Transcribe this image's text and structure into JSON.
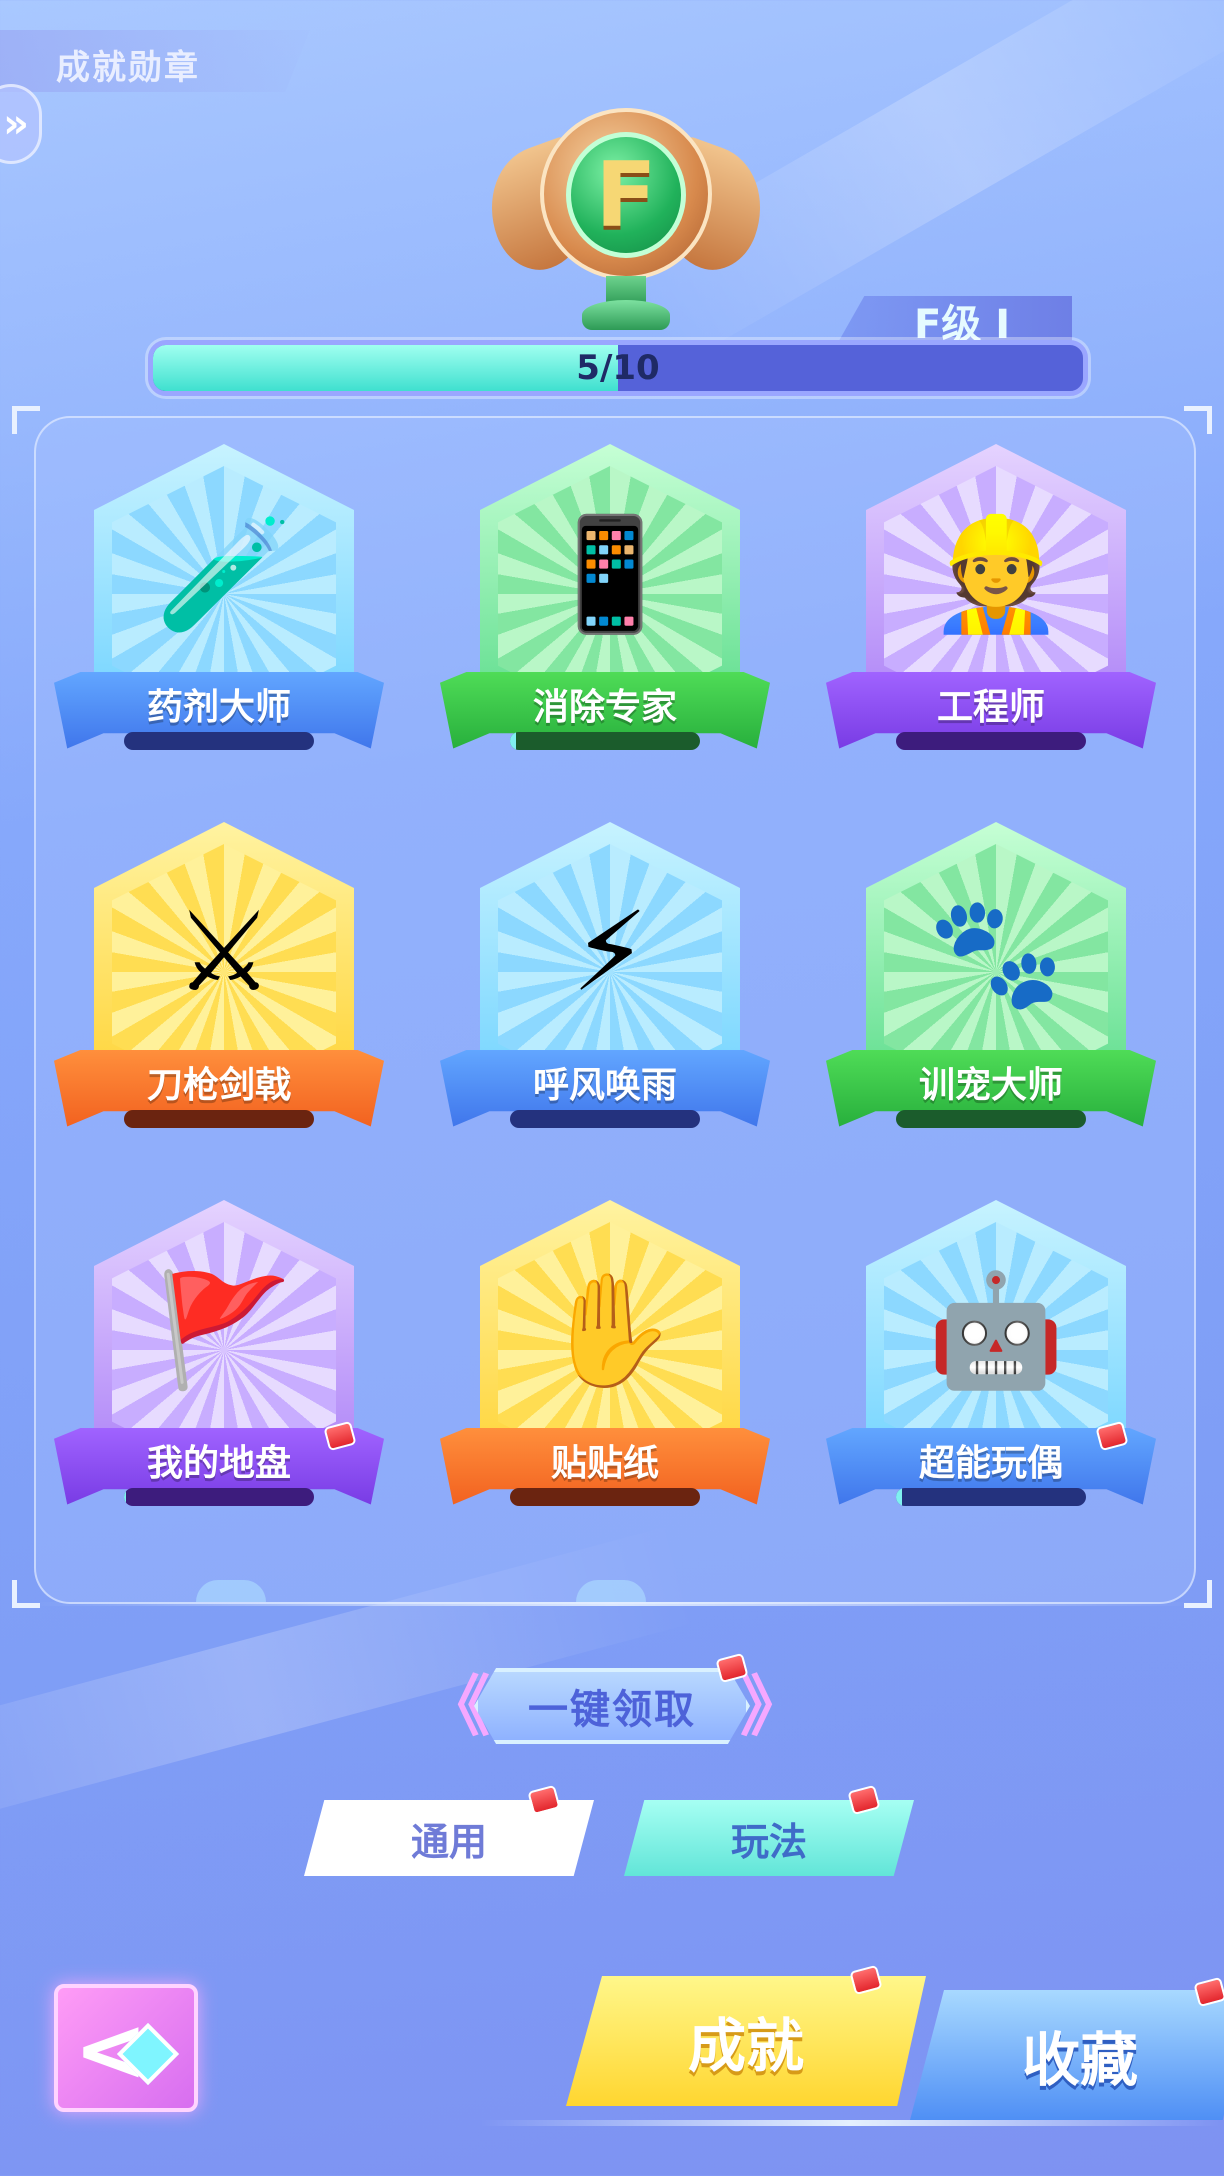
{
  "header": {
    "title": "成就勋章",
    "side_arrow": "»"
  },
  "trophy": {
    "letter": "F"
  },
  "level": {
    "label": "F级 Ⅰ"
  },
  "progress": {
    "current": 5,
    "total": 10,
    "text": "5/10"
  },
  "badges": [
    {
      "name": "药剂大师",
      "art_icon": "potion-flask-icon",
      "art": "🧪",
      "theme": "blue",
      "progress": 0
    },
    {
      "name": "消除专家",
      "art_icon": "phone-swipe-icon",
      "art": "📱",
      "theme": "green",
      "progress": 0.03
    },
    {
      "name": "工程师",
      "art_icon": "hardhat-engineer-icon",
      "art": "👷",
      "theme": "purple",
      "progress": 0
    },
    {
      "name": "刀枪剑戟",
      "art_icon": "crossed-swords-icon",
      "art": "⚔",
      "theme": "yellow",
      "progress": 0
    },
    {
      "name": "呼风唤雨",
      "art_icon": "storm-wizard-icon",
      "art": "⚡",
      "theme": "blue",
      "progress": 0
    },
    {
      "name": "训宠大师",
      "art_icon": "pets-group-icon",
      "art": "🐾",
      "theme": "green",
      "progress": 0
    },
    {
      "name": "我的地盘",
      "art_icon": "flag-man-icon",
      "art": "🚩",
      "theme": "purple",
      "progress": 0.01,
      "dot": true
    },
    {
      "name": "贴贴纸",
      "art_icon": "sticker-hand-icon",
      "art": "✋",
      "theme": "yellow",
      "progress": 0
    },
    {
      "name": "超能玩偶",
      "art_icon": "super-doll-icon",
      "art": "🤖",
      "theme": "blue",
      "progress": 0.03,
      "dot": true
    }
  ],
  "claim_all": {
    "label": "一键领取",
    "chev_left": "《",
    "chev_right": "》"
  },
  "tabs": {
    "general": "通用",
    "gameplay": "玩法"
  },
  "bottom_nav": {
    "back_arrow": "<",
    "achievements": "成就",
    "collection": "收藏"
  }
}
